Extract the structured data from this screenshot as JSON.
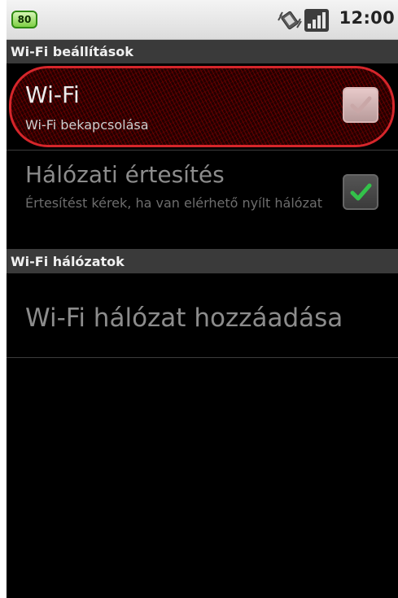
{
  "status_bar": {
    "battery_level": "80",
    "time": "12:00",
    "icons": [
      "vibrate-icon",
      "signal-icon"
    ],
    "battery_color": "#7fcf45"
  },
  "sections": {
    "wifi_settings": "Wi-Fi beállítások",
    "wifi_networks": "Wi-Fi hálózatok"
  },
  "wifi_row": {
    "title": "Wi-Fi",
    "subtitle": "Wi-Fi bekapcsolása",
    "checked": true,
    "highlight_color": "#d5262b"
  },
  "notification_row": {
    "title": "Hálózati értesítés",
    "subtitle": "Értesítést kérek, ha van elérhető nyílt hálózat",
    "checked": true,
    "check_color": "#33c24a"
  },
  "add_network_row": {
    "title": "Wi-Fi hálózat hozzáadása"
  }
}
